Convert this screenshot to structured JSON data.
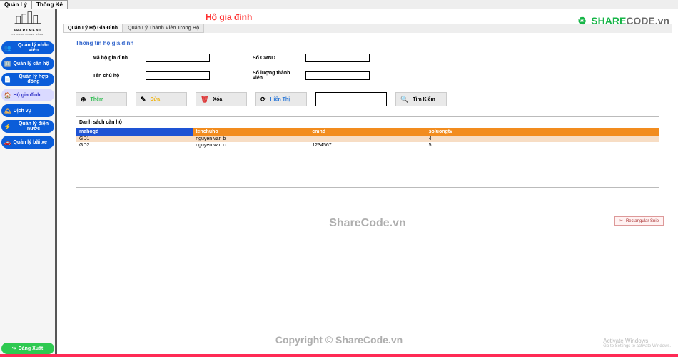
{
  "top_tabs": [
    "Quản Lý",
    "Thống Kê"
  ],
  "logo": {
    "name": "APARTMENT",
    "sub": "CHELSEA TOWER HÀNG"
  },
  "sidebar": {
    "items": [
      {
        "icon": "👥",
        "label": "Quản lý nhân viên"
      },
      {
        "icon": "🏢",
        "label": "Quản lý căn hộ"
      },
      {
        "icon": "📄",
        "label": "Quản lý hợp đồng"
      },
      {
        "icon": "🏠",
        "label": "Hộ gia đình"
      },
      {
        "icon": "🛎",
        "label": "Dịch vụ"
      },
      {
        "icon": "⚡",
        "label": "Quản lý điện nước"
      },
      {
        "icon": "🚗",
        "label": "Quản lý bãi xe"
      }
    ],
    "active_index": 3,
    "logout": {
      "icon": "↪",
      "label": "Đăng Xuất"
    }
  },
  "page_title": "Hộ gia đình",
  "sub_tabs": [
    "Quản Lý Hộ Gia Đình",
    "Quản Lý Thành Viên Trong Hộ"
  ],
  "form": {
    "title": "Thông tin hộ gia đình",
    "fields": {
      "ma_ho": {
        "label": "Mã hộ gia đình",
        "value": ""
      },
      "so_cmnd": {
        "label": "Số CMND",
        "value": ""
      },
      "ten_chu": {
        "label": "Tên chủ hộ",
        "value": ""
      },
      "so_luong": {
        "label": "Số lượng thành viên",
        "value": ""
      }
    }
  },
  "buttons": {
    "them": {
      "label": "Thêm",
      "color": "#2dbb4f"
    },
    "sua": {
      "label": "Sửa",
      "color": "#f0b000"
    },
    "xoa": {
      "label": "Xóa",
      "color": "#000"
    },
    "hienthi": {
      "label": "Hiển Thị",
      "color": "#2b77d6"
    },
    "timkiem": {
      "label": "Tìm Kiếm",
      "color": "#000"
    }
  },
  "search_value": "",
  "list": {
    "title": "Danh sách căn hộ",
    "columns": [
      "mahogd",
      "tenchuho",
      "cmnd",
      "soluongtv"
    ],
    "rows": [
      [
        "GD1",
        "nguyen van b",
        "",
        "4"
      ],
      [
        "GD2",
        "nguyen van c",
        "1234567",
        "5"
      ]
    ]
  },
  "rect_snip": "Rectangular Snip",
  "watermarks": {
    "brand1": "SHARE",
    "brand2": "CODE.vn",
    "center": "ShareCode.vn",
    "copyright": "Copyright © ShareCode.vn",
    "activate1": "Activate Windows",
    "activate2": "Go to Settings to activate Windows."
  }
}
